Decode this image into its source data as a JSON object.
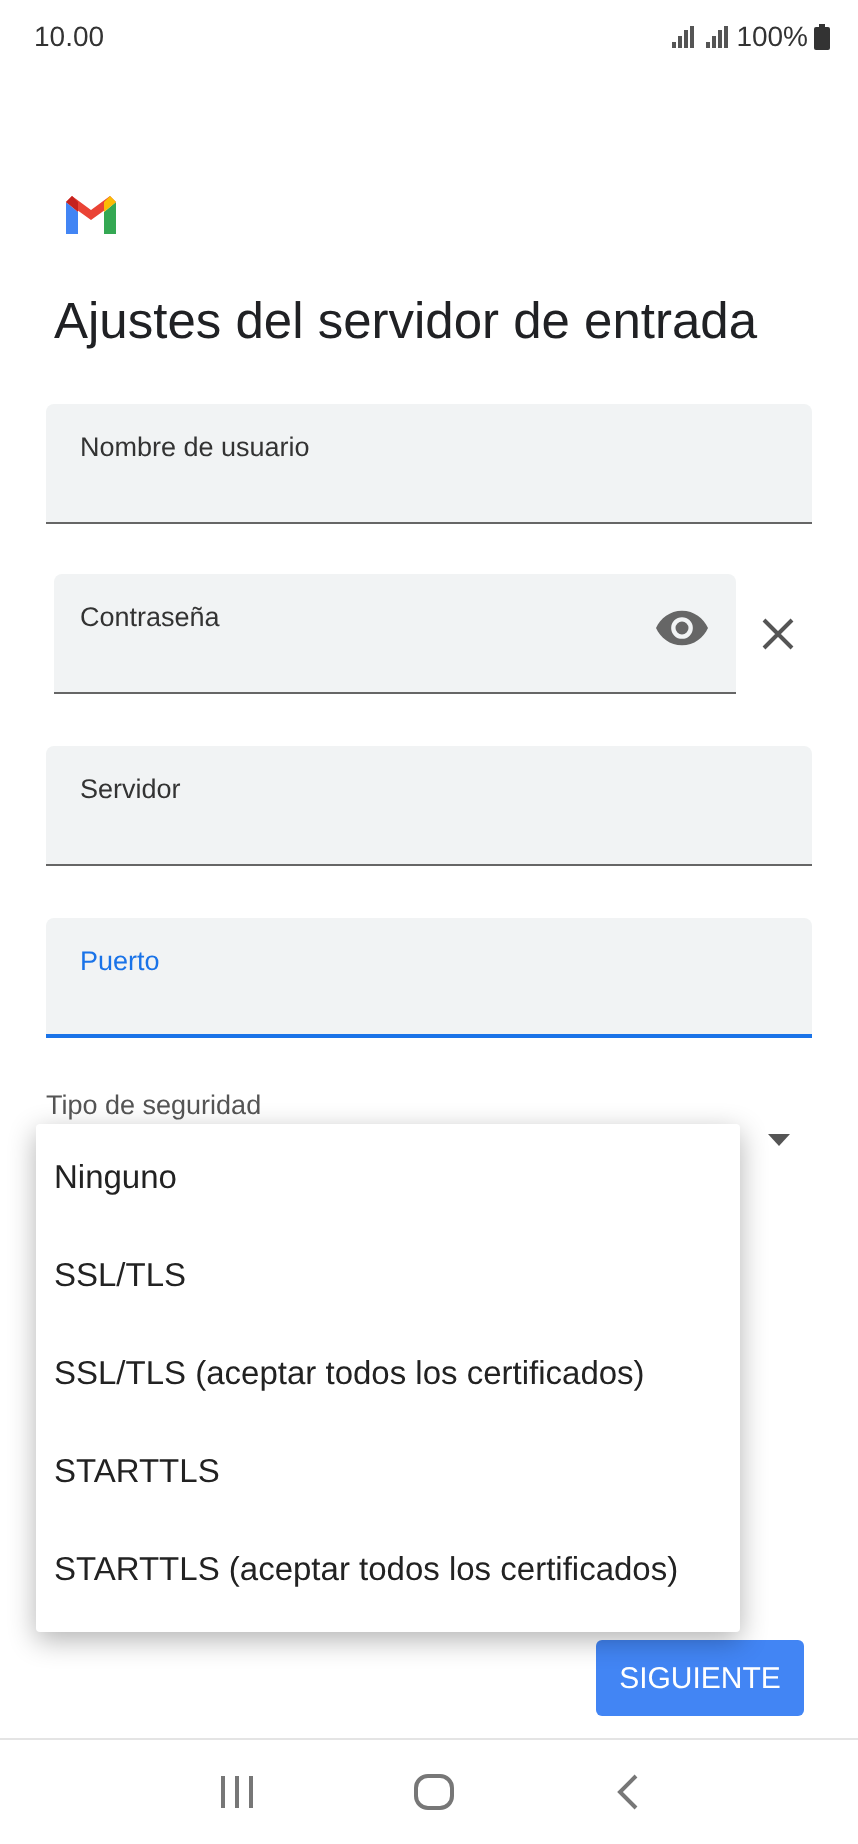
{
  "status_bar": {
    "time": "10.00",
    "battery": "100%"
  },
  "title": "Ajustes del servidor de entrada",
  "fields": [
    {
      "kind": "text",
      "label": "Nombre de usuario",
      "focused": false
    },
    {
      "kind": "password",
      "label": "Contraseña",
      "focused": false
    },
    {
      "kind": "text",
      "label": "Servidor",
      "focused": false
    },
    {
      "kind": "text",
      "label": "Puerto",
      "focused": true
    }
  ],
  "security": {
    "label": "Tipo de seguridad",
    "expanded": true,
    "options": [
      "Ninguno",
      "SSL/TLS",
      "SSL/TLS (aceptar todos los certificados)",
      "STARTTLS",
      "STARTTLS (aceptar todos los certificados)"
    ]
  },
  "next_button": "SIGUIENTE"
}
